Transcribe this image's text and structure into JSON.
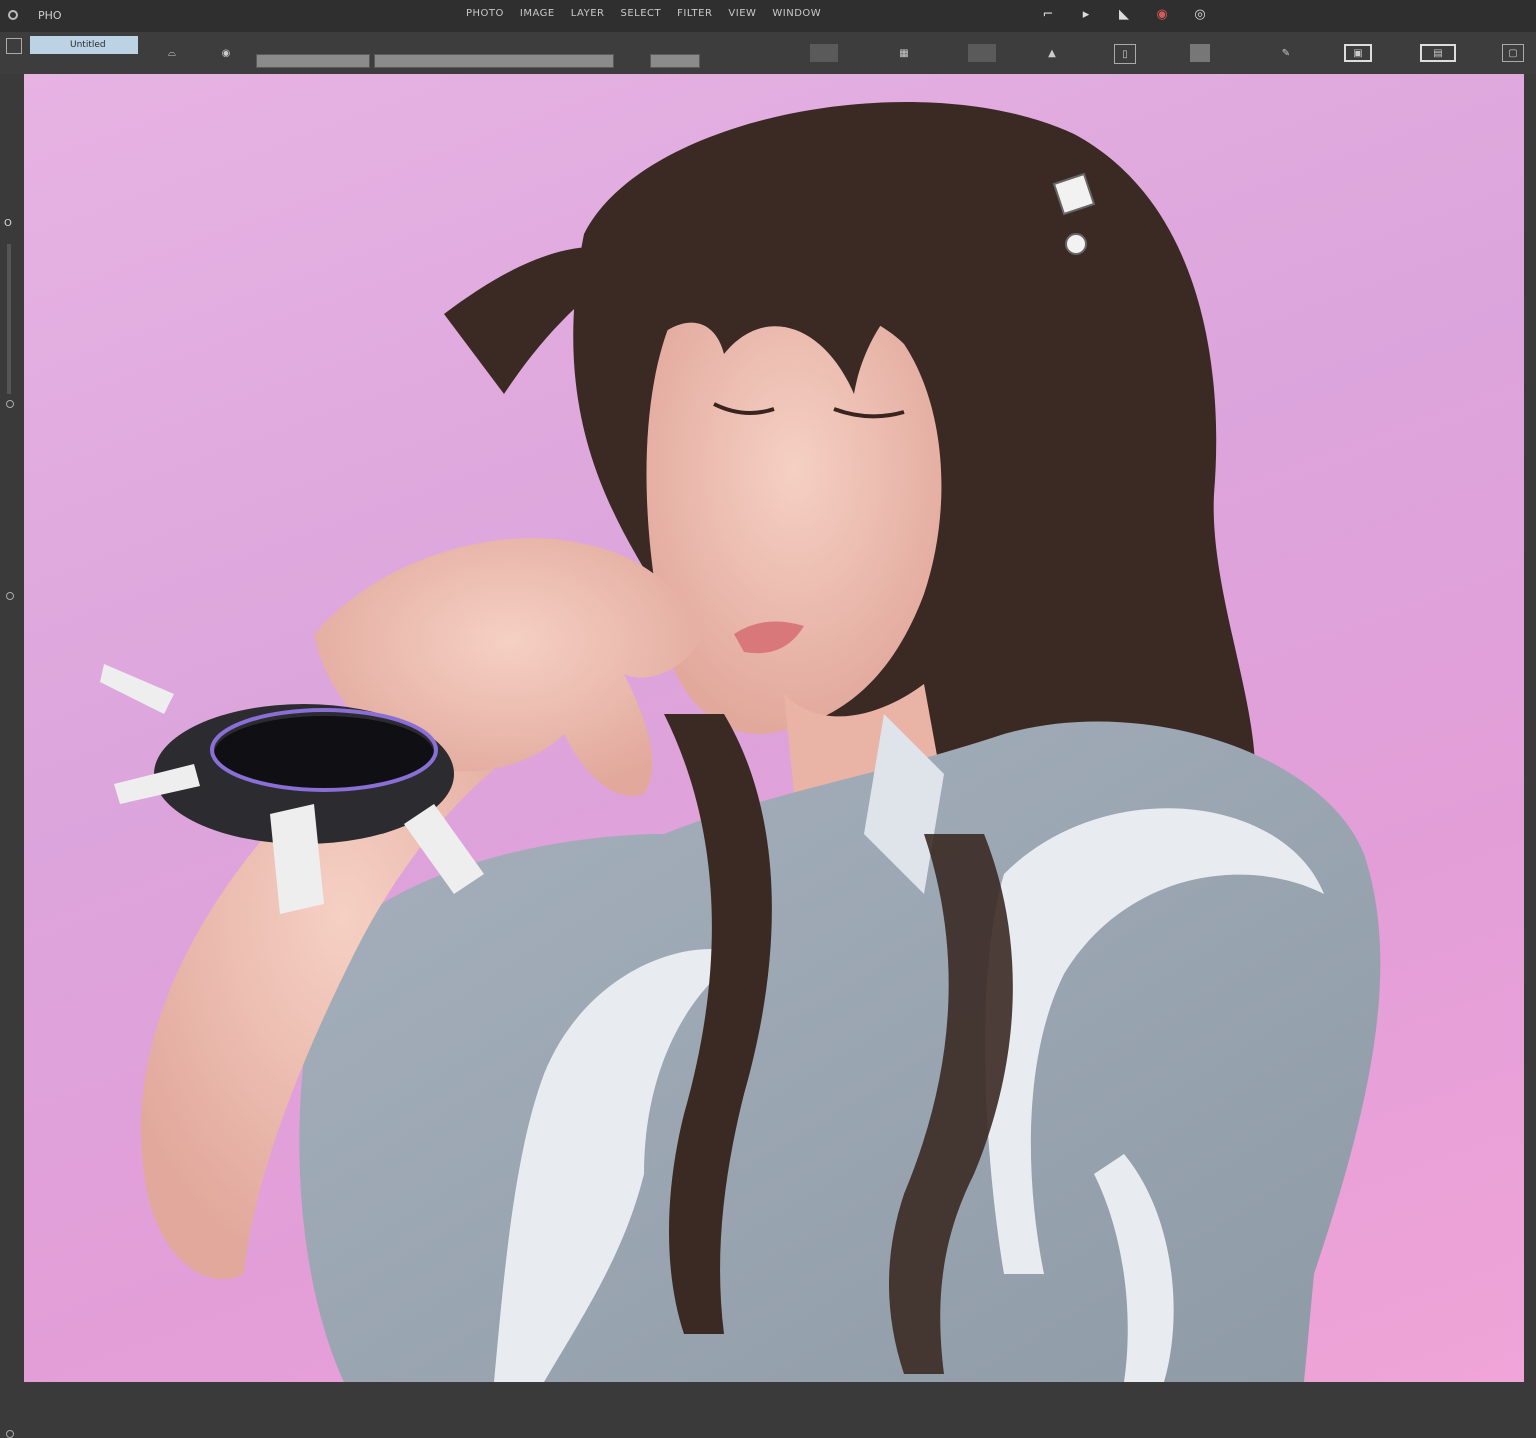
{
  "app": {
    "logo": "PHO",
    "menu": [
      "PHOTO",
      "IMAGE",
      "LAYER",
      "SELECT",
      "FILTER",
      "VIEW",
      "WINDOW"
    ]
  },
  "toolbar": {
    "active_tab": "Untitled",
    "field_1": "",
    "field_2": "",
    "field_3": ""
  },
  "left": {
    "label": "O"
  },
  "colors": {
    "chrome": "#3a3a3a",
    "canvas_bg": "#e3a9df",
    "active_tab": "#bcd3e6"
  },
  "canvas": {
    "icons": [
      "hair-icon",
      "face-icon",
      "hand-icon",
      "jacket-icon",
      "wrist-cuff-icon"
    ]
  }
}
